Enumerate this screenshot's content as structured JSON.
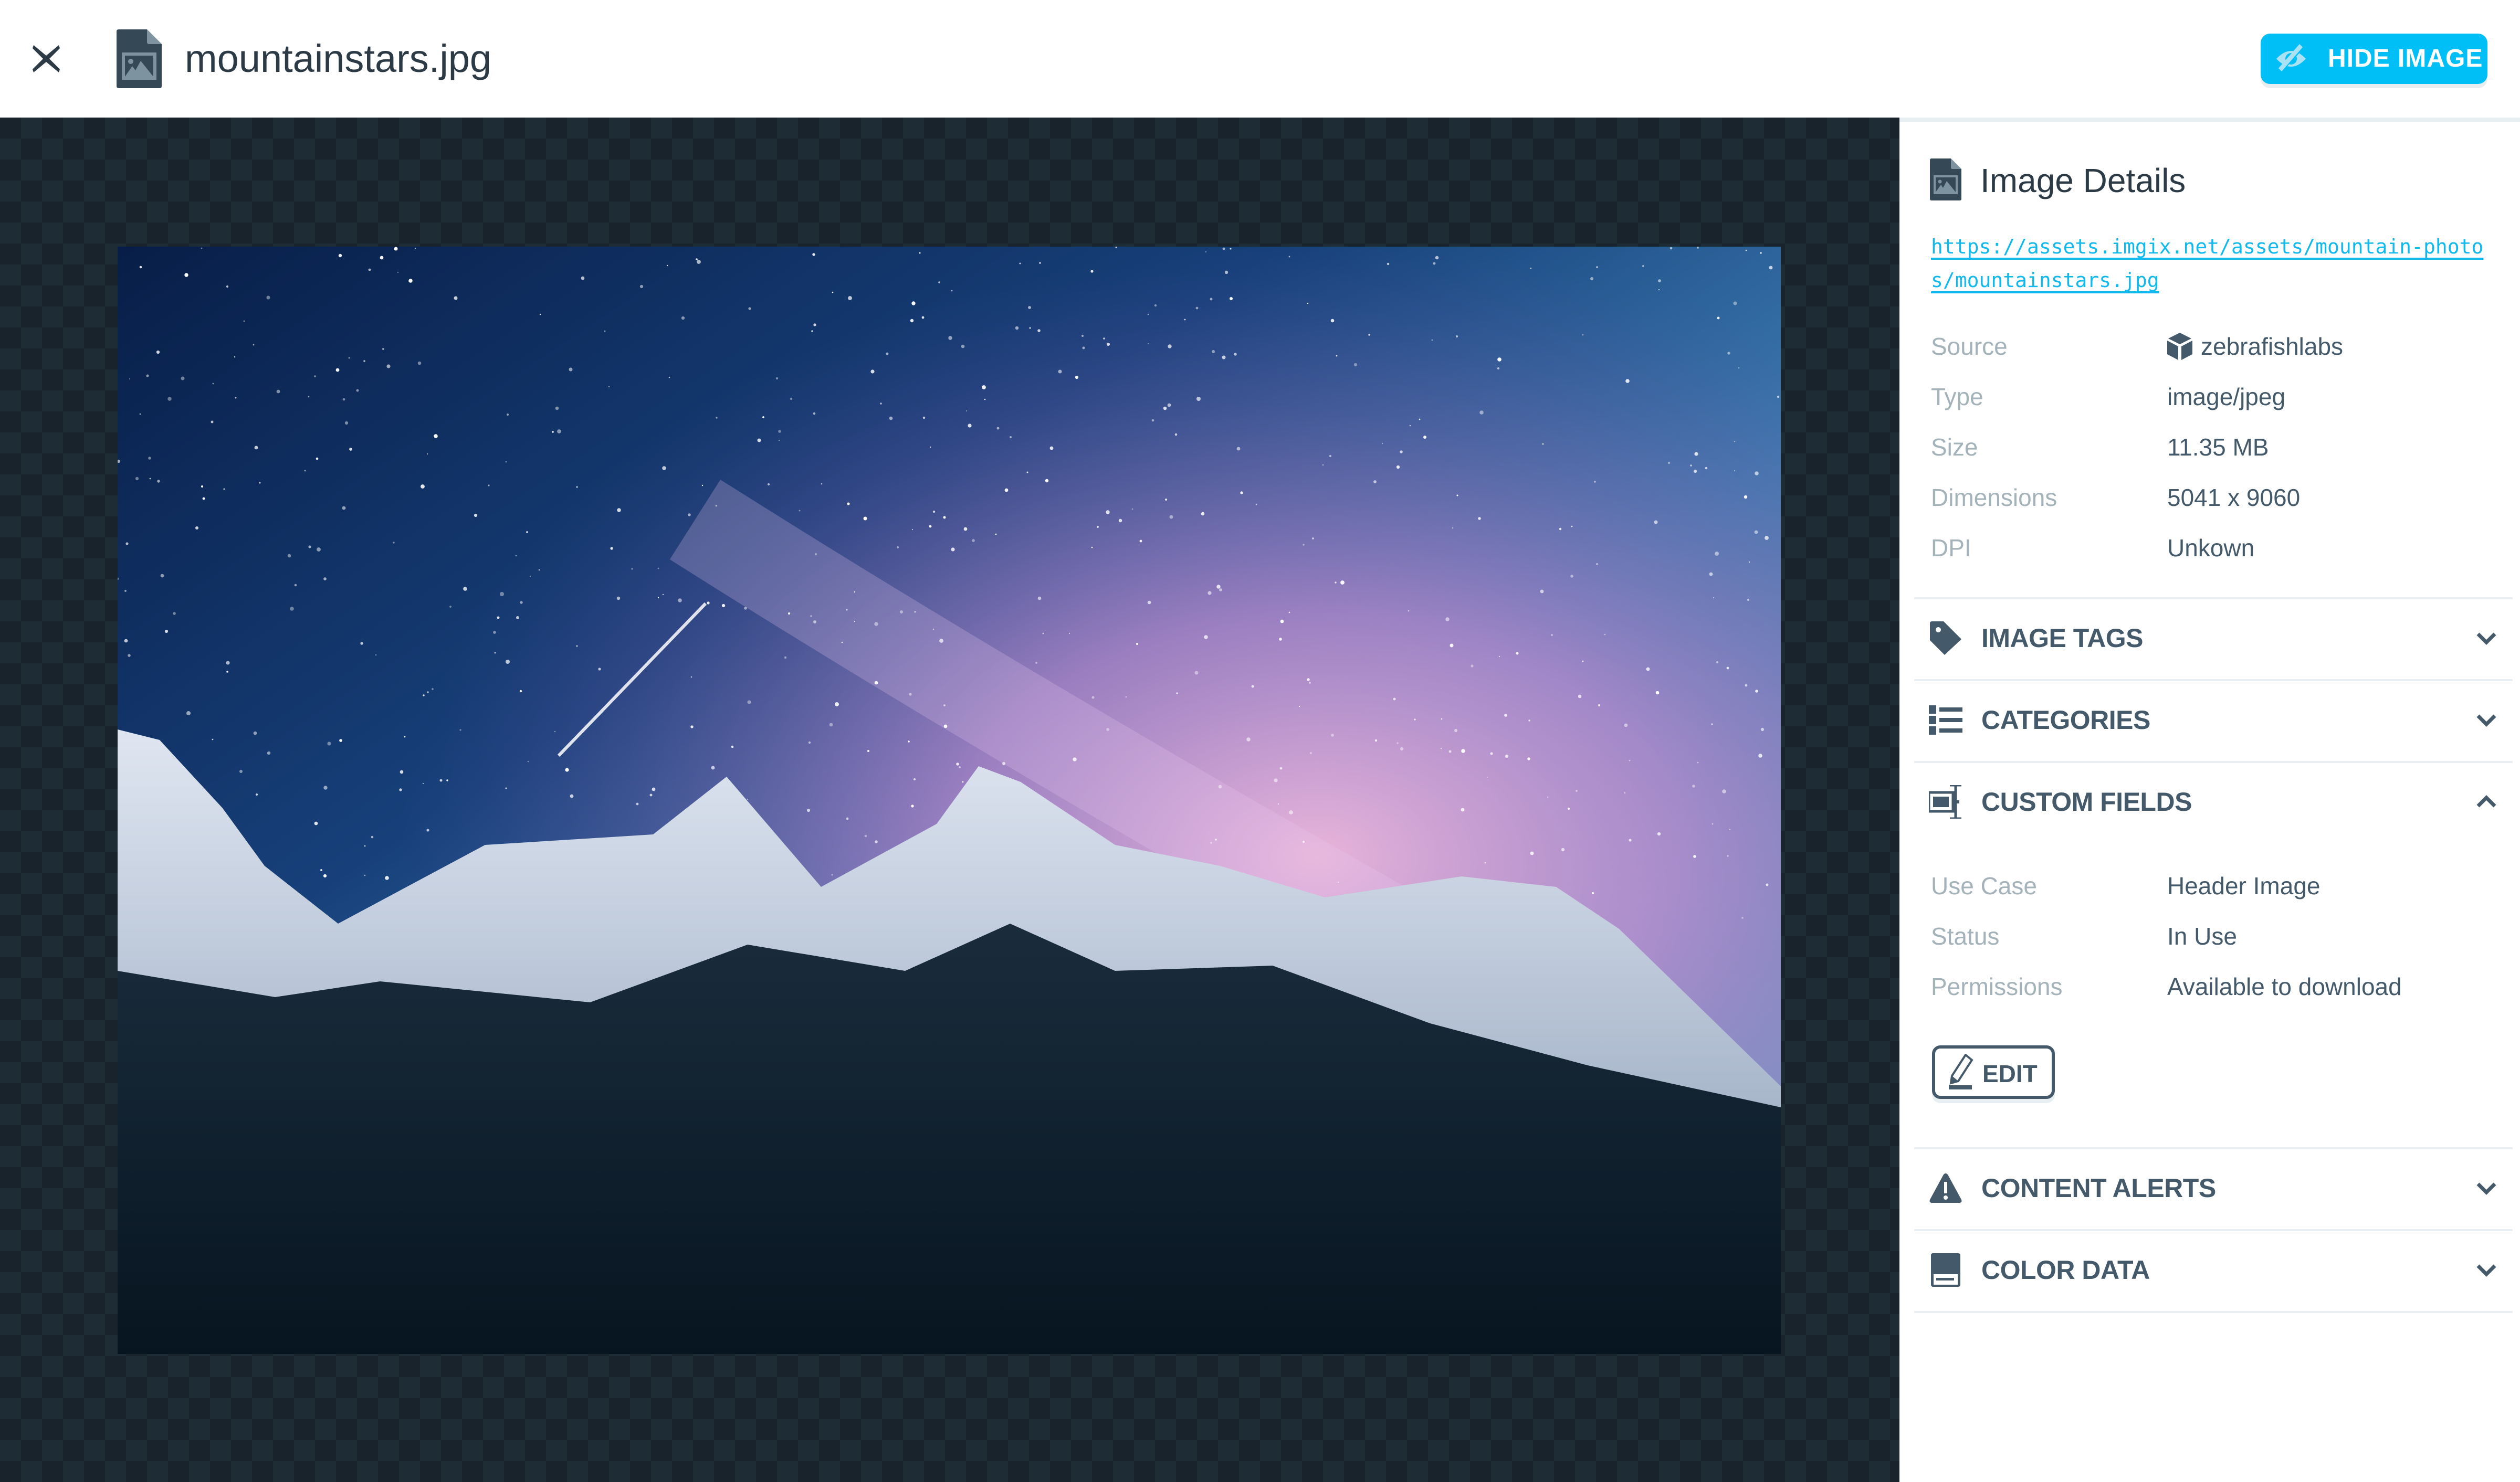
{
  "header": {
    "close_icon": "close-icon",
    "file_icon": "image-file-icon",
    "filename": "mountainstars.jpg",
    "hide_button": {
      "icon": "eye-slash-icon",
      "label": "HIDE IMAGE"
    }
  },
  "viewer": {
    "image_alt": "Night sky with Milky Way over snowy mountains and forest"
  },
  "sidebar": {
    "title": "Image Details",
    "title_icon": "image-file-icon",
    "url": "https://assets.imgix.net/assets/mountain-photos/mountainstars.jpg",
    "details": [
      {
        "key": "Source",
        "value": "zebrafishlabs",
        "icon": "cube-icon"
      },
      {
        "key": "Type",
        "value": "image/jpeg"
      },
      {
        "key": "Size",
        "value": "11.35 MB"
      },
      {
        "key": "Dimensions",
        "value": "5041 x 9060"
      },
      {
        "key": "DPI",
        "value": "Unkown"
      }
    ],
    "sections": [
      {
        "title": "IMAGE TAGS",
        "icon": "tag-icon",
        "expanded": false
      },
      {
        "title": "CATEGORIES",
        "icon": "list-icon",
        "expanded": false
      },
      {
        "title": "CUSTOM FIELDS",
        "icon": "text-field-icon",
        "expanded": true,
        "fields": [
          {
            "key": "Use Case",
            "value": "Header Image"
          },
          {
            "key": "Status",
            "value": "In Use"
          },
          {
            "key": "Permissions",
            "value": "Available to download"
          }
        ],
        "edit_label": "EDIT",
        "edit_icon": "pencil-icon"
      },
      {
        "title": "CONTENT ALERTS",
        "icon": "warning-icon",
        "expanded": false
      },
      {
        "title": "COLOR DATA",
        "icon": "swatch-icon",
        "expanded": false
      }
    ]
  },
  "colors": {
    "accent": "#00bff6",
    "link": "#0fb9ee",
    "text_dark": "#2c3a45",
    "text_slate": "#445a6b",
    "label_gray": "#a4b2ba",
    "divider": "#e8eff2",
    "checker_dark": "#19232c",
    "checker_light": "#1e2c36"
  }
}
